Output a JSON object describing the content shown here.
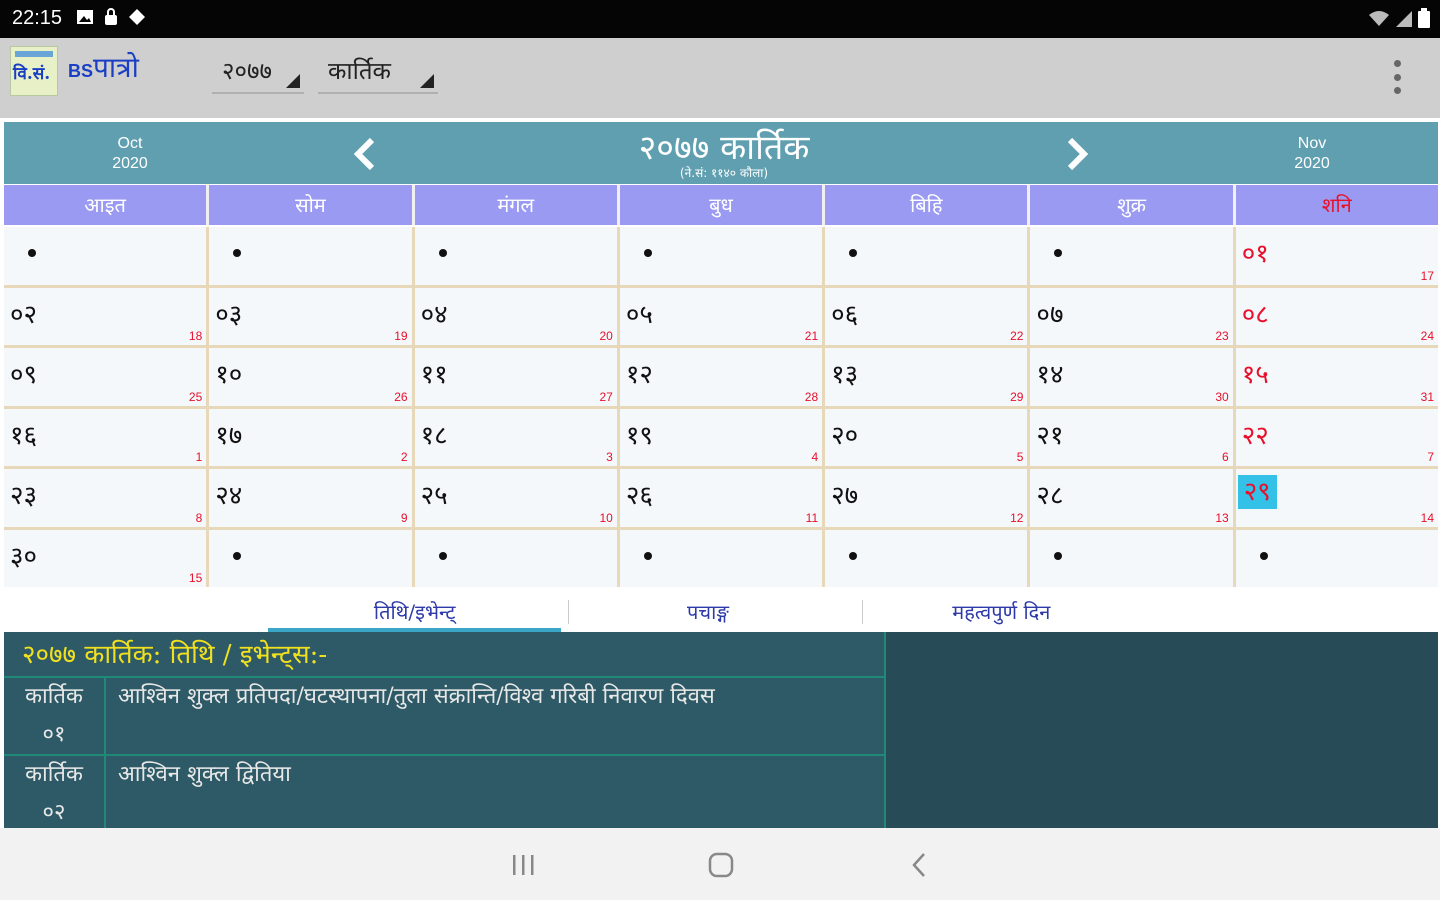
{
  "status_bar": {
    "time": "22:15"
  },
  "app_bar": {
    "logo_text": "वि.सं.",
    "title_prefix": "BS",
    "title_main": "पात्रो",
    "year_value": "२०७७",
    "month_value": "कार्तिक",
    "menu_icon": "more-vert-icon"
  },
  "month_header": {
    "prev_month": "Oct",
    "prev_year": "2020",
    "title": "२०७७ कार्तिक",
    "subtitle": "(ने.सं: ११४० कौला)",
    "next_month": "Nov",
    "next_year": "2020"
  },
  "weekdays": [
    "आइत",
    "सोम",
    "मंगल",
    "बुध",
    "बिहि",
    "शुक्र",
    "शनि"
  ],
  "calendar": {
    "weeks": [
      [
        {
          "np": "",
          "en": ""
        },
        {
          "np": "",
          "en": ""
        },
        {
          "np": "",
          "en": ""
        },
        {
          "np": "",
          "en": ""
        },
        {
          "np": "",
          "en": ""
        },
        {
          "np": "",
          "en": ""
        },
        {
          "np": "०१",
          "en": "17"
        }
      ],
      [
        {
          "np": "०२",
          "en": "18"
        },
        {
          "np": "०३",
          "en": "19"
        },
        {
          "np": "०४",
          "en": "20"
        },
        {
          "np": "०५",
          "en": "21"
        },
        {
          "np": "०६",
          "en": "22"
        },
        {
          "np": "०७",
          "en": "23"
        },
        {
          "np": "०८",
          "en": "24"
        }
      ],
      [
        {
          "np": "०९",
          "en": "25"
        },
        {
          "np": "१०",
          "en": "26"
        },
        {
          "np": "११",
          "en": "27"
        },
        {
          "np": "१२",
          "en": "28"
        },
        {
          "np": "१३",
          "en": "29"
        },
        {
          "np": "१४",
          "en": "30"
        },
        {
          "np": "१५",
          "en": "31"
        }
      ],
      [
        {
          "np": "१६",
          "en": "1"
        },
        {
          "np": "१७",
          "en": "2"
        },
        {
          "np": "१८",
          "en": "3"
        },
        {
          "np": "१९",
          "en": "4"
        },
        {
          "np": "२०",
          "en": "5"
        },
        {
          "np": "२१",
          "en": "6"
        },
        {
          "np": "२२",
          "en": "7"
        }
      ],
      [
        {
          "np": "२३",
          "en": "8"
        },
        {
          "np": "२४",
          "en": "9"
        },
        {
          "np": "२५",
          "en": "10"
        },
        {
          "np": "२६",
          "en": "11"
        },
        {
          "np": "२७",
          "en": "12"
        },
        {
          "np": "२८",
          "en": "13"
        },
        {
          "np": "२९",
          "en": "14",
          "today": true
        }
      ],
      [
        {
          "np": "३०",
          "en": "15"
        },
        {
          "np": "",
          "en": ""
        },
        {
          "np": "",
          "en": ""
        },
        {
          "np": "",
          "en": ""
        },
        {
          "np": "",
          "en": ""
        },
        {
          "np": "",
          "en": ""
        },
        {
          "np": "",
          "en": ""
        }
      ]
    ]
  },
  "tabs": [
    {
      "label": "तिथि/इभेन्ट्",
      "active": true
    },
    {
      "label": "पचाङ्ग",
      "active": false
    },
    {
      "label": "महत्वपुर्ण दिन",
      "active": false
    }
  ],
  "events": {
    "heading": "२०७७ कार्तिक:  तिथि / इभेन्ट्स:-",
    "rows": [
      {
        "month": "कार्तिक",
        "day": "०१",
        "text": "आश्विन शुक्ल प्रतिपदा/घटस्थापना/तुला संक्रान्ति/विश्व गरिबी निवारण दिवस"
      },
      {
        "month": "कार्तिक",
        "day": "०२",
        "text": "आश्विन शुक्ल द्वितिया"
      }
    ]
  },
  "colors": {
    "header_teal": "#5f9fb0",
    "weekday_purple": "#9a9af2",
    "saturday_red": "#e8102a",
    "today_cyan": "#33c1e8",
    "events_bg": "#2d5a66",
    "events_heading": "#f0e020"
  }
}
